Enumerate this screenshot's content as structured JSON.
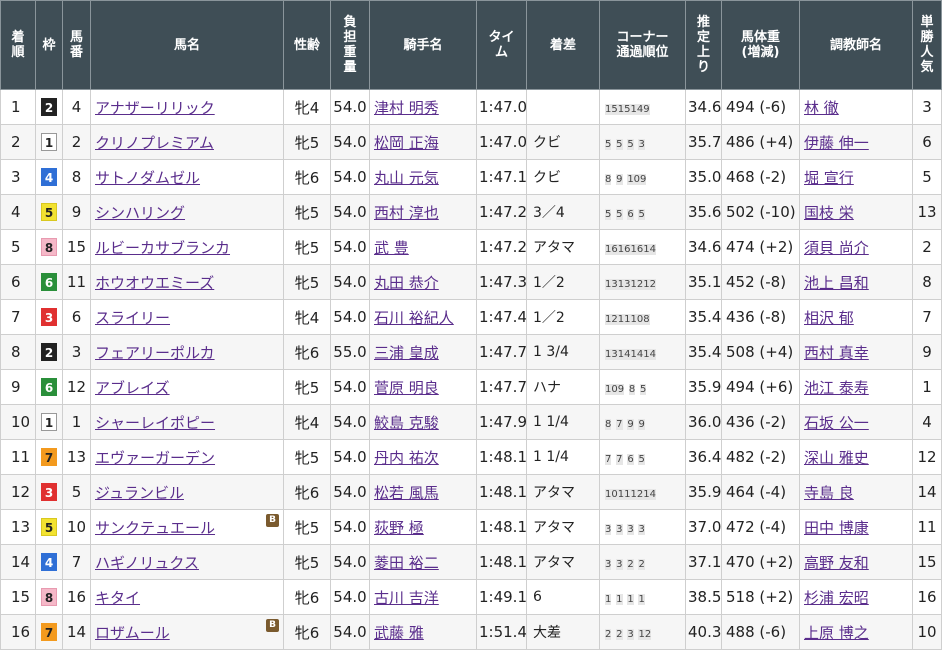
{
  "headers": [
    {
      "key": "rank",
      "lines": [
        "着",
        "順"
      ]
    },
    {
      "key": "waku",
      "lines": [
        "枠"
      ]
    },
    {
      "key": "num",
      "lines": [
        "馬",
        "番"
      ]
    },
    {
      "key": "name",
      "lines": [
        "馬名"
      ]
    },
    {
      "key": "sexage",
      "lines": [
        "性齢"
      ]
    },
    {
      "key": "weight",
      "lines": [
        "負",
        "担",
        "重",
        "量"
      ]
    },
    {
      "key": "jockey",
      "lines": [
        "騎手名"
      ]
    },
    {
      "key": "time",
      "lines": [
        "タイ",
        "ム"
      ]
    },
    {
      "key": "margin",
      "lines": [
        "着差"
      ]
    },
    {
      "key": "corner",
      "lines": [
        "コーナー",
        "通過順位"
      ]
    },
    {
      "key": "last",
      "lines": [
        "推",
        "定",
        "上",
        "り"
      ]
    },
    {
      "key": "body",
      "lines": [
        "馬体重",
        "(増減)"
      ]
    },
    {
      "key": "trainer",
      "lines": [
        "調教師名"
      ]
    },
    {
      "key": "pop",
      "lines": [
        "単",
        "勝",
        "人",
        "気"
      ]
    }
  ],
  "waku_colors": {
    "1": {
      "bg": "#ffffff",
      "fg": "#222222",
      "border": "#999999"
    },
    "2": {
      "bg": "#222222",
      "fg": "#ffffff",
      "border": "#222222"
    },
    "3": {
      "bg": "#e03030",
      "fg": "#ffffff",
      "border": "#e03030"
    },
    "4": {
      "bg": "#2f6fd6",
      "fg": "#ffffff",
      "border": "#2f6fd6"
    },
    "5": {
      "bg": "#f2e230",
      "fg": "#222222",
      "border": "#d9c820"
    },
    "6": {
      "bg": "#2a8f3a",
      "fg": "#ffffff",
      "border": "#2a8f3a"
    },
    "7": {
      "bg": "#f39a1e",
      "fg": "#222222",
      "border": "#f39a1e"
    },
    "8": {
      "bg": "#f5b8c8",
      "fg": "#222222",
      "border": "#e89ab0"
    }
  },
  "rows": [
    {
      "rank": "1",
      "waku": "2",
      "num": "4",
      "name": "アナザーリリック",
      "blinker": "",
      "sexage": "牝4",
      "weight": "54.0",
      "jockey": "津村 明秀",
      "time": "1:47.0",
      "margin": "",
      "corner": [
        "15",
        "15",
        "14",
        "9"
      ],
      "last": "34.6",
      "body": "494 (-6)",
      "trainer": "林 徹",
      "pop": "3"
    },
    {
      "rank": "2",
      "waku": "1",
      "num": "2",
      "name": "クリノプレミアム",
      "blinker": "",
      "sexage": "牝5",
      "weight": "54.0",
      "jockey": "松岡 正海",
      "time": "1:47.0",
      "margin": "クビ",
      "corner": [
        "5",
        "5",
        "5",
        "3"
      ],
      "last": "35.7",
      "body": "486 (+4)",
      "trainer": "伊藤 伸一",
      "pop": "6"
    },
    {
      "rank": "3",
      "waku": "4",
      "num": "8",
      "name": "サトノダムゼル",
      "blinker": "",
      "sexage": "牝6",
      "weight": "54.0",
      "jockey": "丸山 元気",
      "time": "1:47.1",
      "margin": "クビ",
      "corner": [
        "8",
        "9",
        "10",
        "9"
      ],
      "last": "35.0",
      "body": "468 (-2)",
      "trainer": "堀 宣行",
      "pop": "5"
    },
    {
      "rank": "4",
      "waku": "5",
      "num": "9",
      "name": "シンハリング",
      "blinker": "",
      "sexage": "牝5",
      "weight": "54.0",
      "jockey": "西村 淳也",
      "time": "1:47.2",
      "margin": "3／4",
      "corner": [
        "5",
        "5",
        "6",
        "5"
      ],
      "last": "35.6",
      "body": "502 (-10)",
      "trainer": "国枝 栄",
      "pop": "13"
    },
    {
      "rank": "5",
      "waku": "8",
      "num": "15",
      "name": "ルビーカサブランカ",
      "blinker": "",
      "sexage": "牝5",
      "weight": "54.0",
      "jockey": "武 豊",
      "time": "1:47.2",
      "margin": "アタマ",
      "corner": [
        "16",
        "16",
        "16",
        "14"
      ],
      "last": "34.6",
      "body": "474 (+2)",
      "trainer": "須貝 尚介",
      "pop": "2"
    },
    {
      "rank": "6",
      "waku": "6",
      "num": "11",
      "name": "ホウオウエミーズ",
      "blinker": "",
      "sexage": "牝5",
      "weight": "54.0",
      "jockey": "丸田 恭介",
      "time": "1:47.3",
      "margin": "1／2",
      "corner": [
        "13",
        "13",
        "12",
        "12"
      ],
      "last": "35.1",
      "body": "452 (-8)",
      "trainer": "池上 昌和",
      "pop": "8"
    },
    {
      "rank": "7",
      "waku": "3",
      "num": "6",
      "name": "スライリー",
      "blinker": "",
      "sexage": "牝4",
      "weight": "54.0",
      "jockey": "石川 裕紀人",
      "time": "1:47.4",
      "margin": "1／2",
      "corner": [
        "12",
        "11",
        "10",
        "8"
      ],
      "last": "35.4",
      "body": "436 (-8)",
      "trainer": "相沢 郁",
      "pop": "7"
    },
    {
      "rank": "8",
      "waku": "2",
      "num": "3",
      "name": "フェアリーポルカ",
      "blinker": "",
      "sexage": "牝6",
      "weight": "55.0",
      "jockey": "三浦 皇成",
      "time": "1:47.7",
      "margin": "1 3/4",
      "corner": [
        "13",
        "14",
        "14",
        "14"
      ],
      "last": "35.4",
      "body": "508 (+4)",
      "trainer": "西村 真幸",
      "pop": "9"
    },
    {
      "rank": "9",
      "waku": "6",
      "num": "12",
      "name": "アブレイズ",
      "blinker": "",
      "sexage": "牝5",
      "weight": "54.0",
      "jockey": "菅原 明良",
      "time": "1:47.7",
      "margin": "ハナ",
      "corner": [
        "10",
        "9",
        "8",
        "5"
      ],
      "last": "35.9",
      "body": "494 (+6)",
      "trainer": "池江 泰寿",
      "pop": "1"
    },
    {
      "rank": "10",
      "waku": "1",
      "num": "1",
      "name": "シャーレイポピー",
      "blinker": "",
      "sexage": "牝4",
      "weight": "54.0",
      "jockey": "鮫島 克駿",
      "time": "1:47.9",
      "margin": "1 1/4",
      "corner": [
        "8",
        "7",
        "9",
        "9"
      ],
      "last": "36.0",
      "body": "436 (-2)",
      "trainer": "石坂 公一",
      "pop": "4"
    },
    {
      "rank": "11",
      "waku": "7",
      "num": "13",
      "name": "エヴァーガーデン",
      "blinker": "",
      "sexage": "牝5",
      "weight": "54.0",
      "jockey": "丹内 祐次",
      "time": "1:48.1",
      "margin": "1 1/4",
      "corner": [
        "7",
        "7",
        "6",
        "5"
      ],
      "last": "36.4",
      "body": "482 (-2)",
      "trainer": "深山 雅史",
      "pop": "12"
    },
    {
      "rank": "12",
      "waku": "3",
      "num": "5",
      "name": "ジュランビル",
      "blinker": "",
      "sexage": "牝6",
      "weight": "54.0",
      "jockey": "松若 風馬",
      "time": "1:48.1",
      "margin": "アタマ",
      "corner": [
        "10",
        "11",
        "12",
        "14"
      ],
      "last": "35.9",
      "body": "464 (-4)",
      "trainer": "寺島 良",
      "pop": "14"
    },
    {
      "rank": "13",
      "waku": "5",
      "num": "10",
      "name": "サンクテュエール",
      "blinker": "B",
      "sexage": "牝5",
      "weight": "54.0",
      "jockey": "荻野 極",
      "time": "1:48.1",
      "margin": "アタマ",
      "corner": [
        "3",
        "3",
        "3",
        "3"
      ],
      "last": "37.0",
      "body": "472 (-4)",
      "trainer": "田中 博康",
      "pop": "11"
    },
    {
      "rank": "14",
      "waku": "4",
      "num": "7",
      "name": "ハギノリュクス",
      "blinker": "",
      "sexage": "牝5",
      "weight": "54.0",
      "jockey": "菱田 裕二",
      "time": "1:48.1",
      "margin": "アタマ",
      "corner": [
        "3",
        "3",
        "2",
        "2"
      ],
      "last": "37.1",
      "body": "470 (+2)",
      "trainer": "高野 友和",
      "pop": "15"
    },
    {
      "rank": "15",
      "waku": "8",
      "num": "16",
      "name": "キタイ",
      "blinker": "",
      "sexage": "牝6",
      "weight": "54.0",
      "jockey": "古川 吉洋",
      "time": "1:49.1",
      "margin": "6",
      "corner": [
        "1",
        "1",
        "1",
        "1"
      ],
      "last": "38.5",
      "body": "518 (+2)",
      "trainer": "杉浦 宏昭",
      "pop": "16"
    },
    {
      "rank": "16",
      "waku": "7",
      "num": "14",
      "name": "ロザムール",
      "blinker": "B",
      "sexage": "牝6",
      "weight": "54.0",
      "jockey": "武藤 雅",
      "time": "1:51.4",
      "margin": "大差",
      "corner": [
        "2",
        "2",
        "3",
        "12"
      ],
      "last": "40.3",
      "body": "488 (-6)",
      "trainer": "上原 博之",
      "pop": "10"
    }
  ]
}
